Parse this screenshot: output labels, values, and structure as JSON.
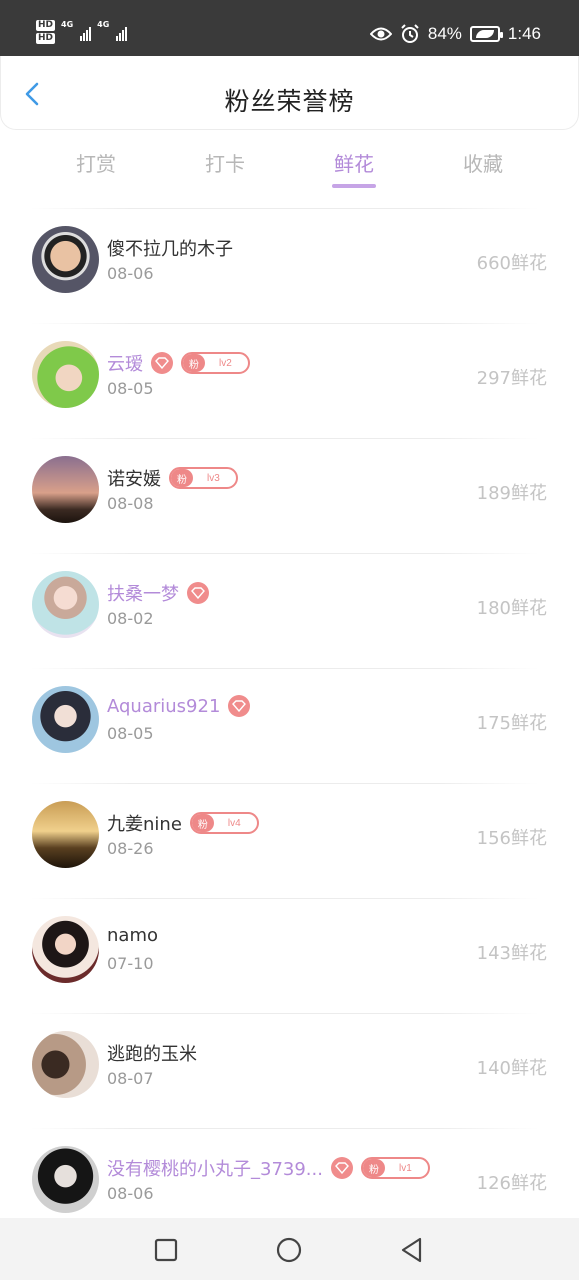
{
  "status_bar": {
    "hd1": "HD",
    "hd2": "HD",
    "net1": "4G",
    "net2": "4G",
    "battery": "84%",
    "time": "1:46",
    "icons": [
      "eye-icon",
      "alarm-icon",
      "battery-icon"
    ]
  },
  "header": {
    "title": "粉丝荣誉榜"
  },
  "tabs": [
    {
      "label": "打赏",
      "active": false
    },
    {
      "label": "打卡",
      "active": false
    },
    {
      "label": "鲜花",
      "active": true
    },
    {
      "label": "收藏",
      "active": false
    }
  ],
  "rows": [
    {
      "name": "傻不拉几的木子",
      "date": "08-06",
      "amount": "660鲜花",
      "vip": false,
      "gem": false,
      "fan": null
    },
    {
      "name": "云瑷",
      "date": "08-05",
      "amount": "297鲜花",
      "vip": true,
      "gem": true,
      "fan": {
        "label": "粉",
        "level": "lv2"
      }
    },
    {
      "name": "诺安媛",
      "date": "08-08",
      "amount": "189鲜花",
      "vip": false,
      "gem": false,
      "fan": {
        "label": "粉",
        "level": "lv3"
      }
    },
    {
      "name": "扶桑一梦",
      "date": "08-02",
      "amount": "180鲜花",
      "vip": true,
      "gem": true,
      "fan": null
    },
    {
      "name": "Aquarius921",
      "date": "08-05",
      "amount": "175鲜花",
      "vip": true,
      "gem": true,
      "fan": null
    },
    {
      "name": "九姜nine",
      "date": "08-26",
      "amount": "156鲜花",
      "vip": false,
      "gem": false,
      "fan": {
        "label": "粉",
        "level": "lv4"
      }
    },
    {
      "name": "namo",
      "date": "07-10",
      "amount": "143鲜花",
      "vip": false,
      "gem": false,
      "fan": null
    },
    {
      "name": "逃跑的玉米",
      "date": "08-07",
      "amount": "140鲜花",
      "vip": false,
      "gem": false,
      "fan": null
    },
    {
      "name": "没有樱桃的小丸子_3739...",
      "date": "08-06",
      "amount": "126鲜花",
      "vip": true,
      "gem": true,
      "fan": {
        "label": "粉",
        "level": "lv1"
      }
    }
  ],
  "colors": {
    "accent": "#b38bd9",
    "badge": "#ee8888",
    "status_bar": "#3a3a3a",
    "back_arrow": "#3f9ae6"
  },
  "navbar": {
    "icons": [
      "square-recent-icon",
      "circle-home-icon",
      "triangle-back-icon"
    ]
  }
}
